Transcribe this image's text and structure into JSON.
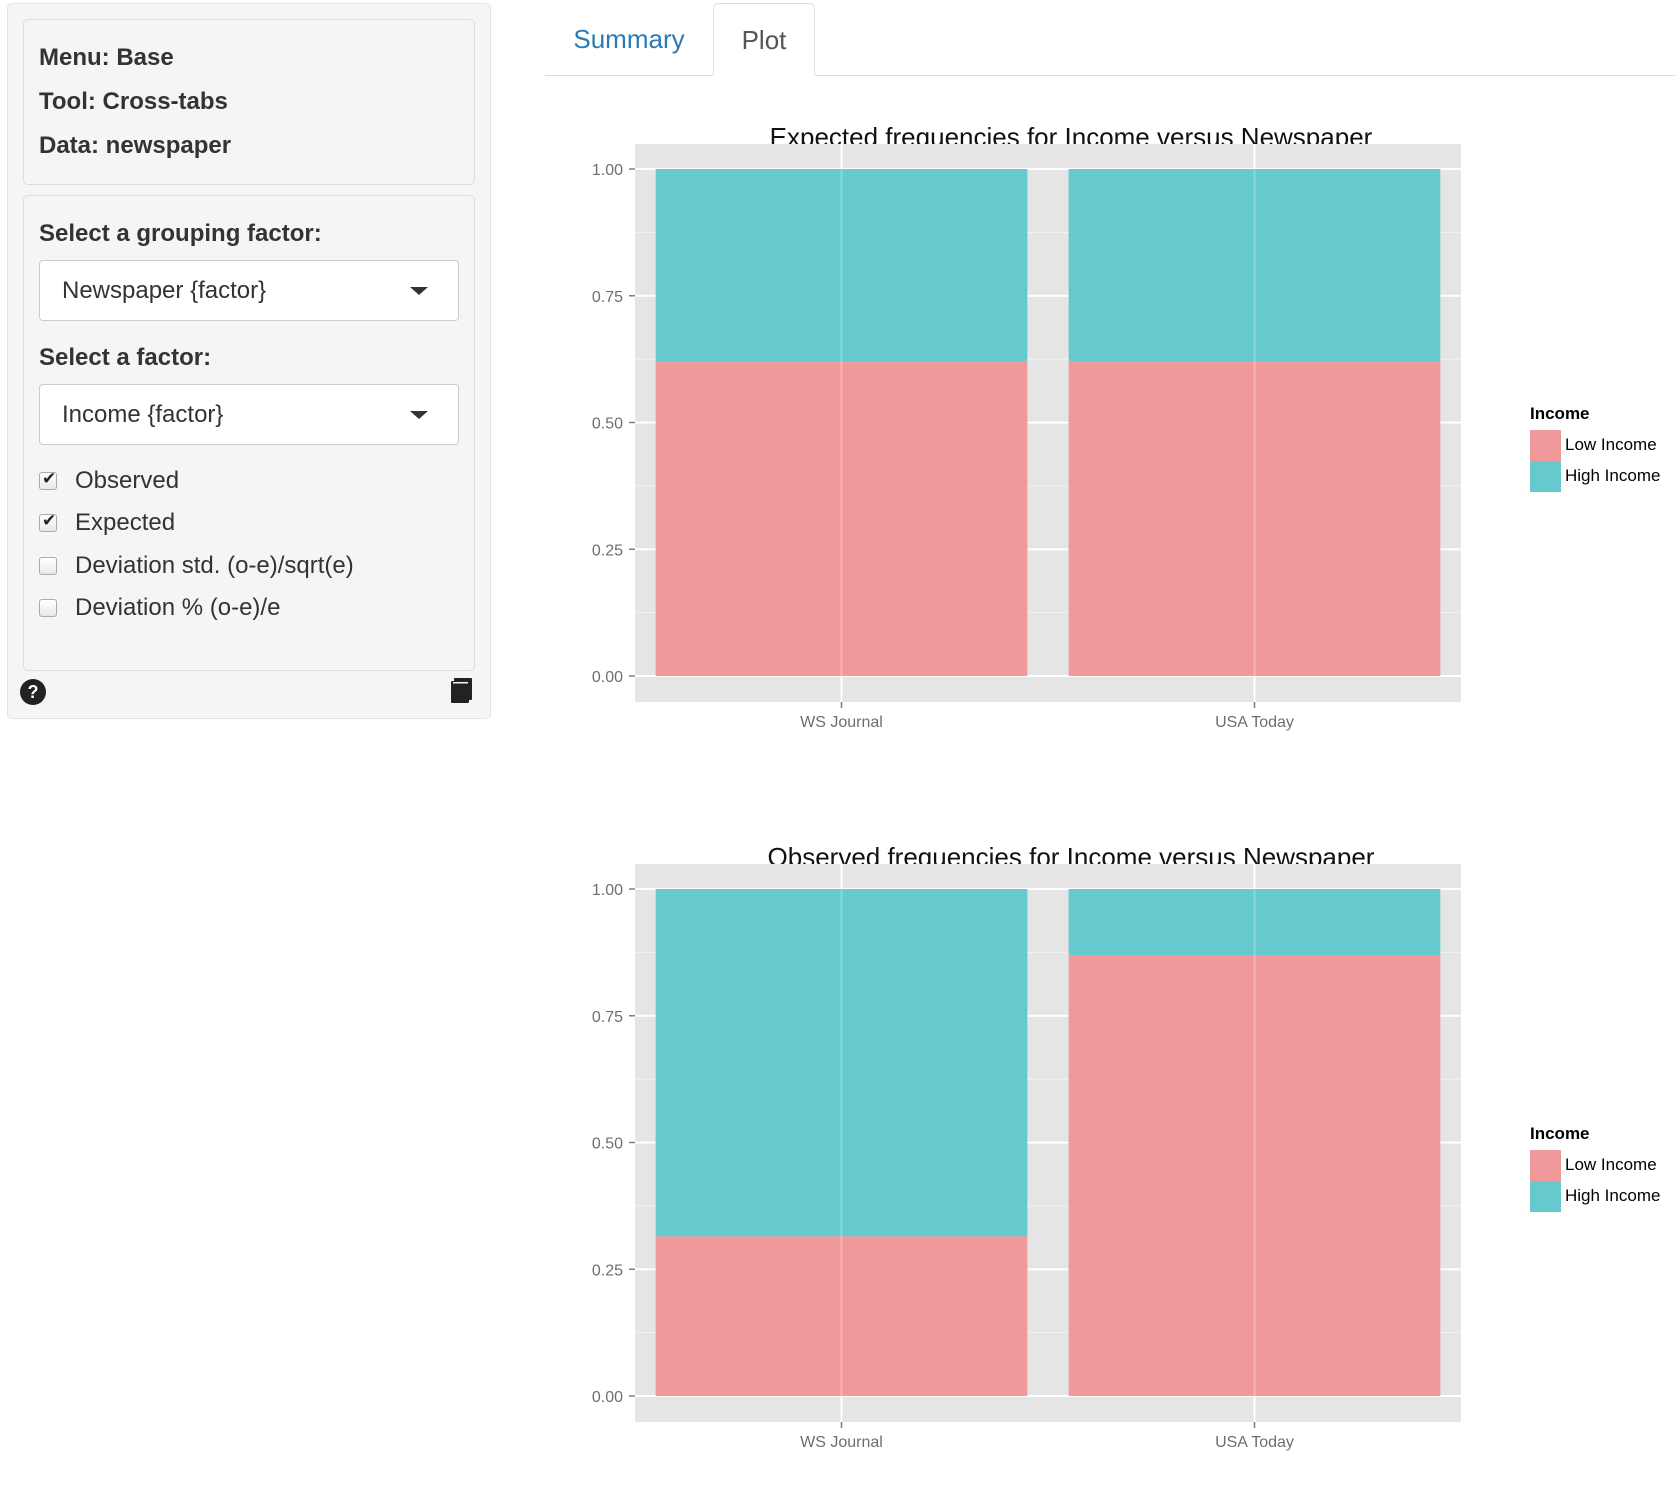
{
  "sidebar": {
    "info": {
      "menu": "Menu: Base",
      "tool": "Tool: Cross-tabs",
      "data": "Data: newspaper"
    },
    "grouping_label": "Select a grouping factor:",
    "grouping_value": "Newspaper {factor}",
    "factor_label": "Select a factor:",
    "factor_value": "Income {factor}",
    "checkboxes": [
      {
        "label": "Observed",
        "checked": true
      },
      {
        "label": "Expected",
        "checked": true
      },
      {
        "label": "Deviation std. (o-e)/sqrt(e)",
        "checked": false
      },
      {
        "label": "Deviation % (o-e)/e",
        "checked": false
      }
    ],
    "help_icon": "question-circle-icon",
    "report_icon": "book-icon"
  },
  "tabs": [
    {
      "label": "Summary",
      "active": false
    },
    {
      "label": "Plot",
      "active": true
    }
  ],
  "colors": {
    "low_income": "#F0999A",
    "high_income": "#66C9CE",
    "panel_bg": "#E5E5E5",
    "grid": "#FFFFFF",
    "tab_link": "#2A7AB8"
  },
  "chart_data": [
    {
      "type": "bar",
      "stacked": true,
      "title": "Expected frequencies for Income versus Newspaper",
      "categories": [
        "WS Journal",
        "USA Today"
      ],
      "series": [
        {
          "name": "Low Income",
          "values": [
            0.62,
            0.62
          ]
        },
        {
          "name": "High Income",
          "values": [
            0.38,
            0.38
          ]
        }
      ],
      "yticks": [
        "0.00",
        "0.25",
        "0.50",
        "0.75",
        "1.00"
      ],
      "ylim": [
        0,
        1
      ],
      "legend_title": "Income",
      "legend_position": "right",
      "grid": true
    },
    {
      "type": "bar",
      "stacked": true,
      "title": "Observed frequencies for Income versus Newspaper",
      "categories": [
        "WS Journal",
        "USA Today"
      ],
      "series": [
        {
          "name": "Low Income",
          "values": [
            0.315,
            0.87
          ]
        },
        {
          "name": "High Income",
          "values": [
            0.685,
            0.13
          ]
        }
      ],
      "yticks": [
        "0.00",
        "0.25",
        "0.50",
        "0.75",
        "1.00"
      ],
      "ylim": [
        0,
        1
      ],
      "legend_title": "Income",
      "legend_position": "right",
      "grid": true
    }
  ]
}
